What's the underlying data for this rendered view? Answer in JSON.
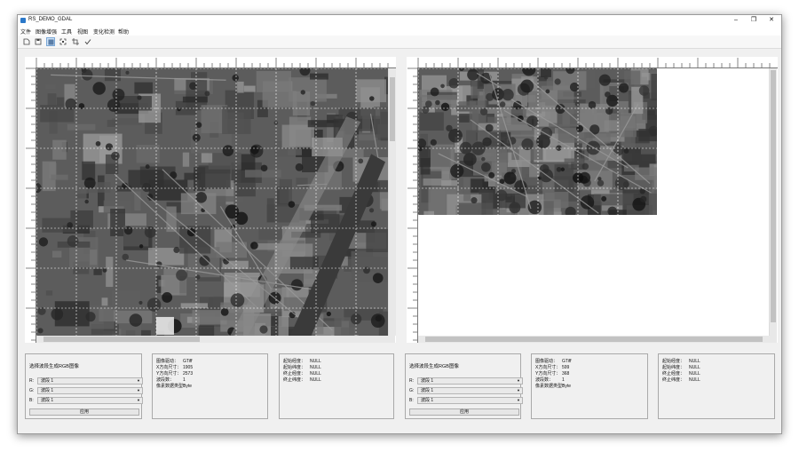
{
  "window": {
    "title": "RS_DEMO_GDAL",
    "minimize_icon": "minimize-icon",
    "maximize_icon": "maximize-icon",
    "close_icon": "close-icon"
  },
  "menu": [
    "文件",
    "图像增强",
    "工具",
    "视图",
    "变化检测",
    "帮助"
  ],
  "toolbar": [
    "open-file-icon",
    "save-icon",
    "grid-view-icon",
    "zoom-fit-icon",
    "crop-icon",
    "check-icon"
  ],
  "left_panel": {
    "title": "选择波段生成RGB图像",
    "rows": [
      {
        "label": "R:",
        "value": "波段 1"
      },
      {
        "label": "G:",
        "value": "波段 1"
      },
      {
        "label": "B:",
        "value": "波段 1"
      }
    ],
    "apply": "应用"
  },
  "left_info": [
    {
      "key": "图像驱动：",
      "value": "GTiff"
    },
    {
      "key": "X方向尺寸：",
      "value": "1905"
    },
    {
      "key": "Y方向尺寸：",
      "value": "2573"
    },
    {
      "key": "波段数：",
      "value": "1"
    },
    {
      "key": "像素数据类型：",
      "value": "Byte"
    }
  ],
  "left_coords": [
    {
      "key": "起始经度：",
      "value": "NULL"
    },
    {
      "key": "起始纬度：",
      "value": "NULL"
    },
    {
      "key": "终止经度：",
      "value": "NULL"
    },
    {
      "key": "终止纬度：",
      "value": "NULL"
    }
  ],
  "right_panel": {
    "title": "选择波段生成RGB图像",
    "rows": [
      {
        "label": "R:",
        "value": "波段 1"
      },
      {
        "label": "G:",
        "value": "波段 1"
      },
      {
        "label": "B:",
        "value": "波段 1"
      }
    ],
    "apply": "应用"
  },
  "right_info": [
    {
      "key": "图像驱动：",
      "value": "GTiff"
    },
    {
      "key": "X方向尺寸：",
      "value": "599"
    },
    {
      "key": "Y方向尺寸：",
      "value": "368"
    },
    {
      "key": "波段数：",
      "value": "1"
    },
    {
      "key": "像素数据类型：",
      "value": "Byte"
    }
  ],
  "right_coords": [
    {
      "key": "起始经度：",
      "value": "NULL"
    },
    {
      "key": "起始纬度：",
      "value": "NULL"
    },
    {
      "key": "终止经度：",
      "value": "NULL"
    },
    {
      "key": "终止纬度：",
      "value": "NULL"
    }
  ]
}
